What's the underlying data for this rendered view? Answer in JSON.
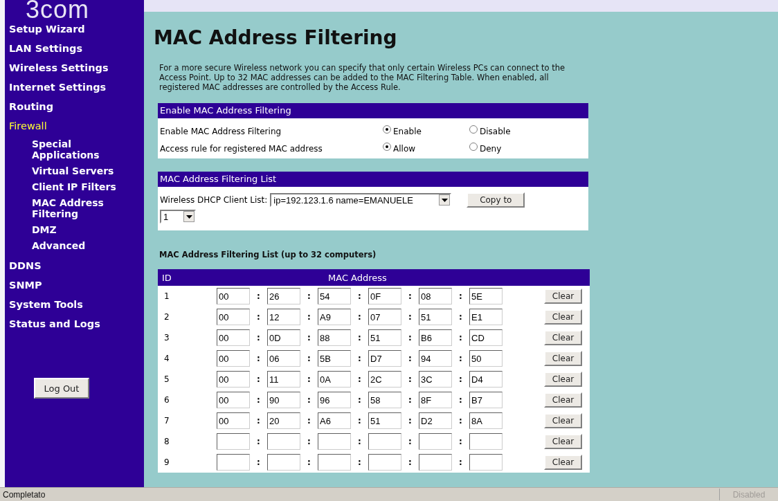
{
  "logo": "3com",
  "sidebar": {
    "items": [
      {
        "label": "Setup Wizard",
        "selected": false
      },
      {
        "label": "LAN Settings",
        "selected": false
      },
      {
        "label": "Wireless Settings",
        "selected": false
      },
      {
        "label": "Internet Settings",
        "selected": false
      },
      {
        "label": "Routing",
        "selected": false
      },
      {
        "label": "Firewall",
        "selected": true,
        "children": [
          {
            "label": "Special Applications",
            "selected": false
          },
          {
            "label": "Virtual Servers",
            "selected": false
          },
          {
            "label": "Client IP Filters",
            "selected": false
          },
          {
            "label": "MAC Address Filtering",
            "selected": false
          },
          {
            "label": "DMZ",
            "selected": false
          },
          {
            "label": "Advanced",
            "selected": false
          }
        ]
      },
      {
        "label": "DDNS",
        "selected": false
      },
      {
        "label": "SNMP",
        "selected": false
      },
      {
        "label": "System Tools",
        "selected": false
      },
      {
        "label": "Status and Logs",
        "selected": false
      }
    ],
    "logout_button": "Log Out"
  },
  "page": {
    "title": "MAC Address Filtering",
    "intro": "For a more secure Wireless network you can specify that only certain Wireless PCs can connect to the Access Point. Up to 32 MAC addresses can be added to the MAC Filtering Table. When enabled, all registered MAC addresses are controlled by the Access Rule."
  },
  "enable_section": {
    "header": "Enable MAC Address Filtering",
    "rows": [
      {
        "label": "Enable MAC Address Filtering",
        "options": [
          {
            "label": "Enable",
            "selected": true
          },
          {
            "label": "Disable",
            "selected": false
          }
        ]
      },
      {
        "label": "Access rule for registered MAC address",
        "options": [
          {
            "label": "Allow",
            "selected": true
          },
          {
            "label": "Deny",
            "selected": false
          }
        ]
      }
    ]
  },
  "list_section": {
    "header": "MAC Address Filtering List",
    "client_label": "Wireless DHCP Client List:",
    "client_select": "ip=192.123.1.6 name=EMANUELE",
    "copy_button": "Copy to",
    "id_select": "1"
  },
  "table": {
    "caption": "MAC Address Filtering List (up to 32 computers)",
    "columns": [
      "ID",
      "MAC Address"
    ],
    "rows": [
      {
        "id": "1",
        "octets": [
          "00",
          "26",
          "54",
          "0F",
          "08",
          "5E"
        ],
        "separators": [
          ":",
          ":",
          ":",
          ":",
          ":"
        ],
        "clear_button": "Clear"
      },
      {
        "id": "2",
        "octets": [
          "00",
          "12",
          "A9",
          "07",
          "51",
          "E1"
        ],
        "separators": [
          ":",
          ":",
          ":",
          ":",
          ":"
        ],
        "clear_button": "Clear"
      },
      {
        "id": "3",
        "octets": [
          "00",
          "0D",
          "88",
          "51",
          "B6",
          "CD"
        ],
        "separators": [
          ":",
          ":",
          ":",
          ":",
          ":"
        ],
        "clear_button": "Clear"
      },
      {
        "id": "4",
        "octets": [
          "00",
          "06",
          "5B",
          "D7",
          "94",
          "50"
        ],
        "separators": [
          ":",
          ":",
          ":",
          ":",
          ":"
        ],
        "clear_button": "Clear"
      },
      {
        "id": "5",
        "octets": [
          "00",
          "11",
          "0A",
          "2C",
          "3C",
          "D4"
        ],
        "separators": [
          ":",
          ":",
          ":",
          ":",
          ":"
        ],
        "clear_button": "Clear"
      },
      {
        "id": "6",
        "octets": [
          "00",
          "90",
          "96",
          "58",
          "8F",
          "B7"
        ],
        "separators": [
          ":",
          ":",
          ":",
          ":",
          ":"
        ],
        "clear_button": "Clear"
      },
      {
        "id": "7",
        "octets": [
          "00",
          "20",
          "A6",
          "51",
          "D2",
          "8A"
        ],
        "separators": [
          ":",
          ":",
          ":",
          ":",
          ":"
        ],
        "clear_button": "Clear"
      },
      {
        "id": "8",
        "separators": [
          ":",
          ":",
          ":",
          ":",
          ":"
        ],
        "clear_button": "Clear"
      },
      {
        "id": "9",
        "separators": [
          ":",
          ":",
          ":",
          ":",
          ":"
        ],
        "clear_button": "Clear"
      }
    ]
  },
  "status_bar": {
    "text": "Completato",
    "zone": "Disabled"
  }
}
